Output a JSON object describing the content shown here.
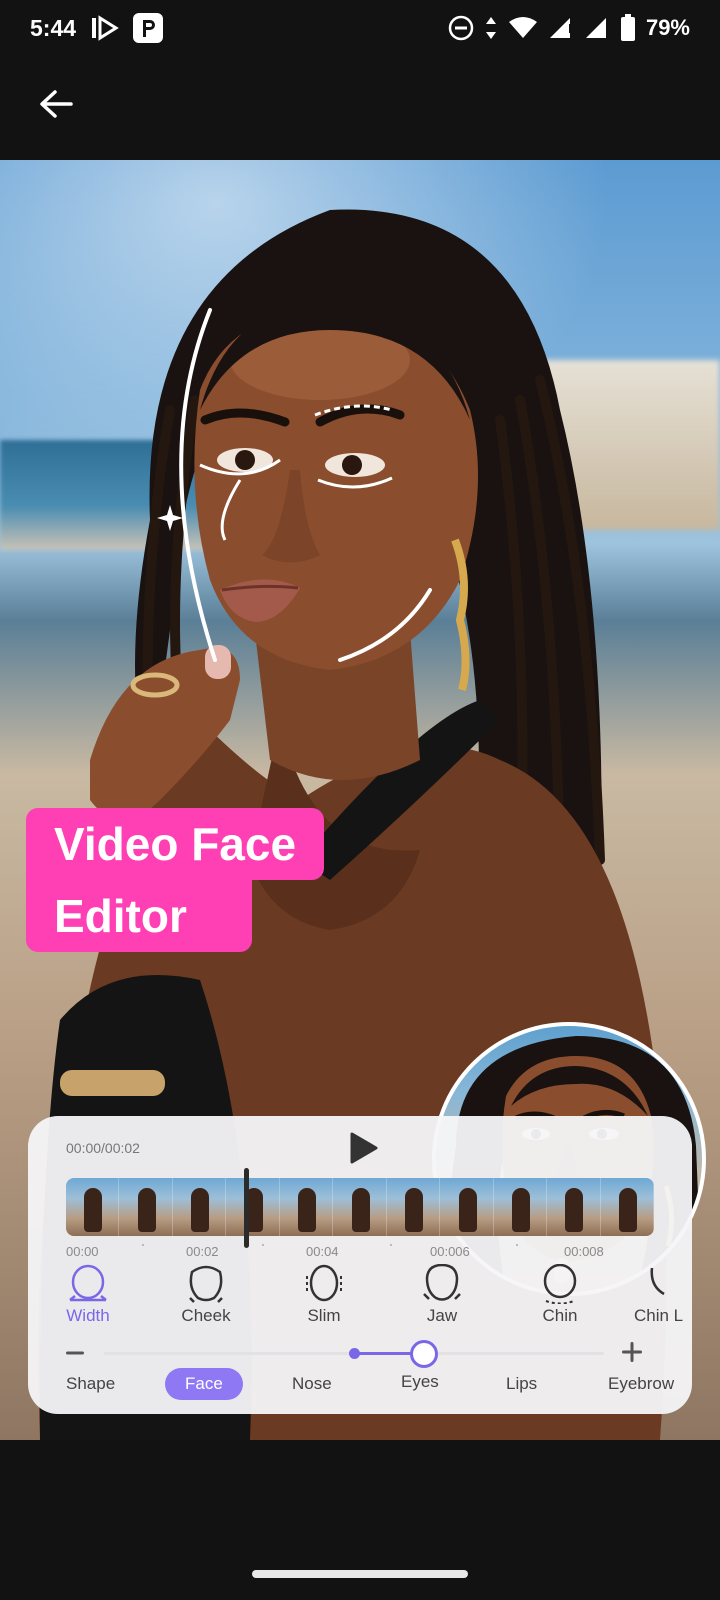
{
  "status_bar": {
    "time": "5:44",
    "battery_percent": "79%",
    "icons": [
      "media-icon",
      "parking-app-icon",
      "dnd-icon",
      "data-arrows-icon",
      "wifi-icon",
      "signal-icon",
      "signal-icon",
      "battery-icon"
    ]
  },
  "nav": {
    "back_icon": "arrow-left-icon"
  },
  "promo": {
    "line1": "Video Face",
    "line2": "Editor"
  },
  "editor": {
    "time_readout": "00:00/00:02",
    "play_icon": "play-icon",
    "timeline_frames": 11,
    "ticks": [
      "00:00",
      "00:02",
      "00:04",
      "00:006",
      "00:008"
    ],
    "tools": [
      {
        "label": "Width",
        "icon": "face-width-icon",
        "active": true
      },
      {
        "label": "Cheek",
        "icon": "face-cheek-icon",
        "active": false
      },
      {
        "label": "Slim",
        "icon": "face-slim-icon",
        "active": false
      },
      {
        "label": "Jaw",
        "icon": "face-jaw-icon",
        "active": false
      },
      {
        "label": "Chin",
        "icon": "face-chin-icon",
        "active": false
      },
      {
        "label": "Chin L",
        "icon": "face-chin-length-icon",
        "active": false
      }
    ],
    "slider": {
      "min_icon": "minus-icon",
      "max_icon": "plus-icon",
      "origin": 0.5,
      "value": 0.64
    },
    "categories": [
      {
        "label": "Shape",
        "active": false
      },
      {
        "label": "Face",
        "active": true
      },
      {
        "label": "Nose",
        "active": false
      },
      {
        "label": "Eyes",
        "active": false
      },
      {
        "label": "Lips",
        "active": false
      },
      {
        "label": "Eyebrow",
        "active": false
      }
    ],
    "accent_color": "#7a67e8"
  },
  "colors": {
    "promo_bg": "#ff3fb4",
    "background": "#121212"
  }
}
